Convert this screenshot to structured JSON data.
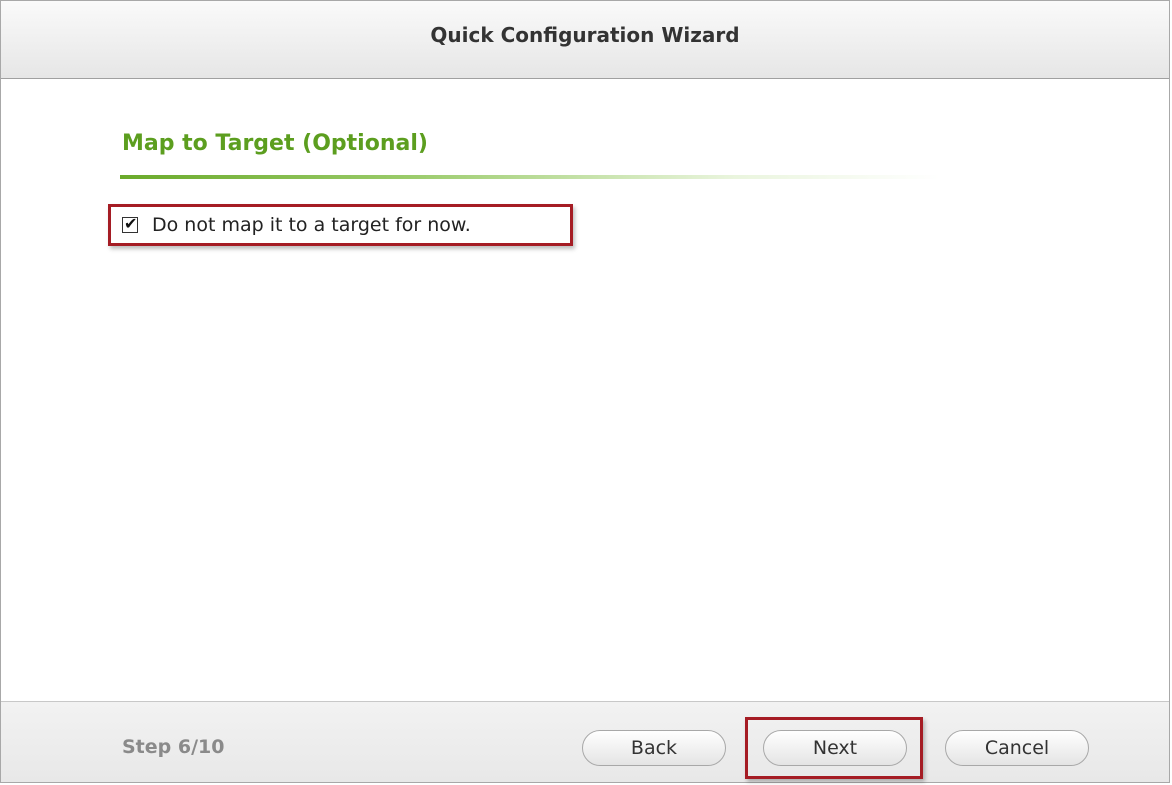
{
  "window": {
    "title": "Quick Configuration Wizard"
  },
  "section": {
    "title": "Map to Target (Optional)"
  },
  "option": {
    "checked": true,
    "check_glyph": "✔",
    "label": "Do not map it to a target for now."
  },
  "footer": {
    "step": "Step 6/10",
    "back_label": "Back",
    "next_label": "Next",
    "cancel_label": "Cancel"
  },
  "colors": {
    "accent_green": "#5c9e1f",
    "highlight_red": "#a51c24"
  }
}
